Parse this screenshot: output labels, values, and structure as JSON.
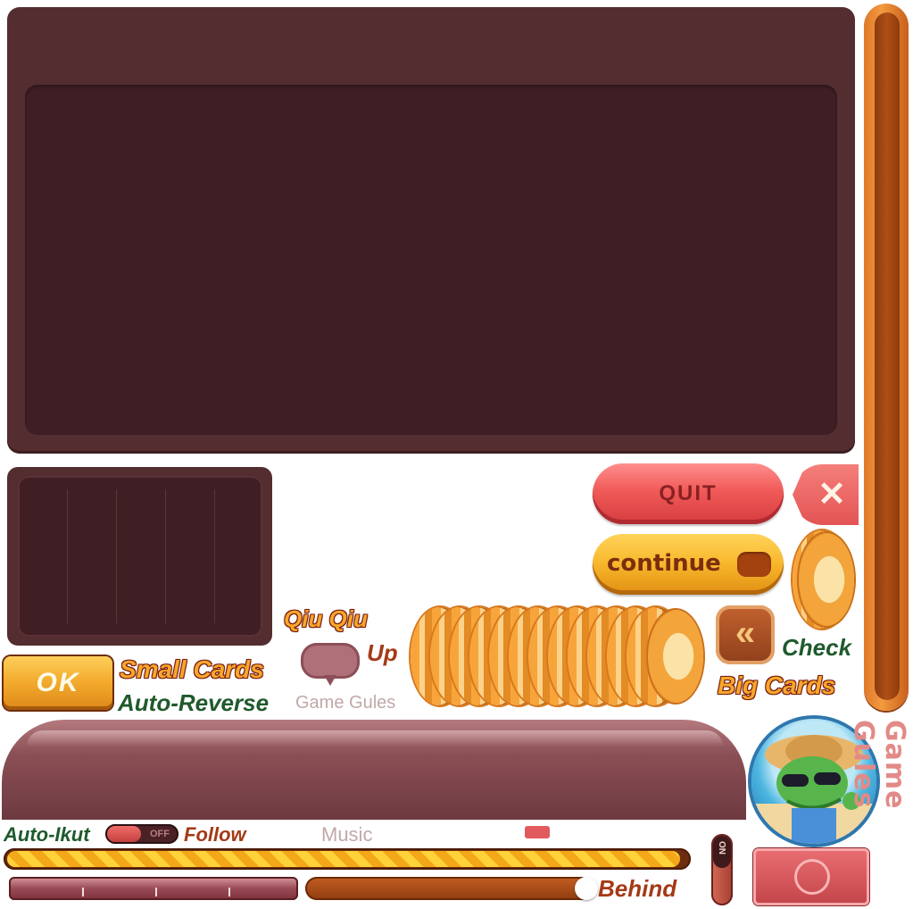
{
  "buttons": {
    "quit": "QUIT",
    "close": "✕",
    "continue": "continue",
    "ok": "OK",
    "rewind": "«"
  },
  "labels": {
    "qiu_qiu": "Qiu Qiu",
    "up": "Up",
    "small_cards": "Small Cards",
    "auto_reverse": "Auto-Reverse",
    "game_gules_small": "Game Gules",
    "check": "Check",
    "big_cards": "Big Cards",
    "auto_ikut": "Auto-Ikut",
    "follow": "Follow",
    "music": "Music",
    "behind": "Behind",
    "brand_vertical": "Game Gules"
  },
  "toggles": {
    "auto_ikut_state": "OFF",
    "vertical_state": "ON"
  },
  "progress": {
    "yellow_fill_fraction": 0.99,
    "slider_fraction": 0.95
  },
  "colors": {
    "panel": "#532d2f",
    "panel_inner": "#3f1e24",
    "quit": "#f05a58",
    "continue": "#f8b62a",
    "accent_orange": "#f29a3f"
  }
}
